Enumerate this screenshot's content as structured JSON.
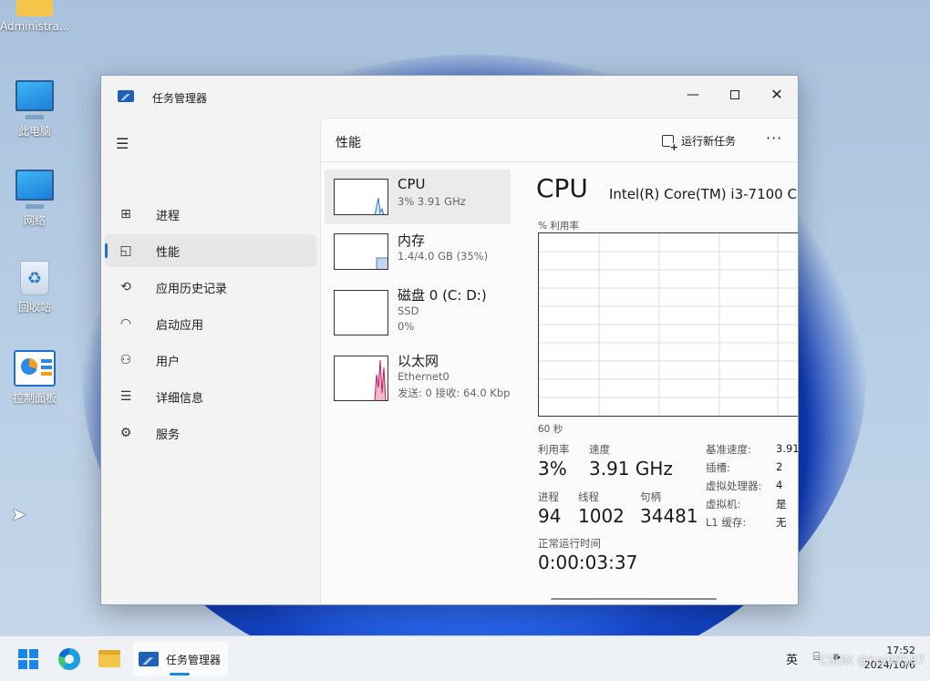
{
  "desktop": {
    "icons": [
      {
        "label": "Administra...",
        "icon": "folder-icon"
      },
      {
        "label": "此电脑",
        "icon": "computer-icon"
      },
      {
        "label": "网络",
        "icon": "network-icon"
      },
      {
        "label": "回收站",
        "icon": "recycle-bin-icon"
      },
      {
        "label": "控制面板",
        "icon": "control-panel-icon"
      }
    ]
  },
  "window": {
    "title": "任务管理器",
    "controls": {
      "minimize": "—",
      "maximize": "□",
      "close": "✕"
    }
  },
  "sidebar": {
    "items": [
      {
        "label": "进程",
        "icon": "processes-icon"
      },
      {
        "label": "性能",
        "icon": "performance-icon",
        "active": true
      },
      {
        "label": "应用历史记录",
        "icon": "app-history-icon"
      },
      {
        "label": "启动应用",
        "icon": "startup-apps-icon"
      },
      {
        "label": "用户",
        "icon": "users-icon"
      },
      {
        "label": "详细信息",
        "icon": "details-icon"
      },
      {
        "label": "服务",
        "icon": "services-icon"
      }
    ],
    "settings": "设置"
  },
  "main": {
    "title": "性能",
    "run_new_task": "运行新任务",
    "more": "···"
  },
  "resources": [
    {
      "name": "CPU",
      "line1": "3% 3.91 GHz",
      "line2": ""
    },
    {
      "name": "内存",
      "line1": "1.4/4.0 GB (35%)",
      "line2": ""
    },
    {
      "name": "磁盘 0 (C: D:)",
      "line1": "SSD",
      "line2": "0%"
    },
    {
      "name": "以太网",
      "line1": "Ethernet0",
      "line2": "发送: 0 接收: 64.0 Kbp"
    }
  ],
  "detail": {
    "heading": "CPU",
    "model": "Intel(R) Core(TM) i3-7100 C",
    "util_label": "% 利用率",
    "time_label": "60 秒",
    "utilization_label": "利用率",
    "utilization": "3%",
    "speed_label": "速度",
    "speed": "3.91 GHz",
    "processes_label": "进程",
    "processes": "94",
    "threads_label": "线程",
    "threads": "1002",
    "handles_label": "句柄",
    "handles": "34481",
    "uptime_label": "正常运行时间",
    "uptime": "0:00:03:37",
    "specs": [
      {
        "k": "基准速度:",
        "v": "3.91"
      },
      {
        "k": "插槽:",
        "v": "2"
      },
      {
        "k": "虚拟处理器:",
        "v": "4"
      },
      {
        "k": "虚拟机:",
        "v": "是"
      },
      {
        "k": "L1 缓存:",
        "v": "无"
      }
    ]
  },
  "taskbar": {
    "app_label": "任务管理器",
    "lang": "英",
    "time": "17:52",
    "date": "2024/10/6"
  },
  "watermark": "CSDN @hai40587"
}
